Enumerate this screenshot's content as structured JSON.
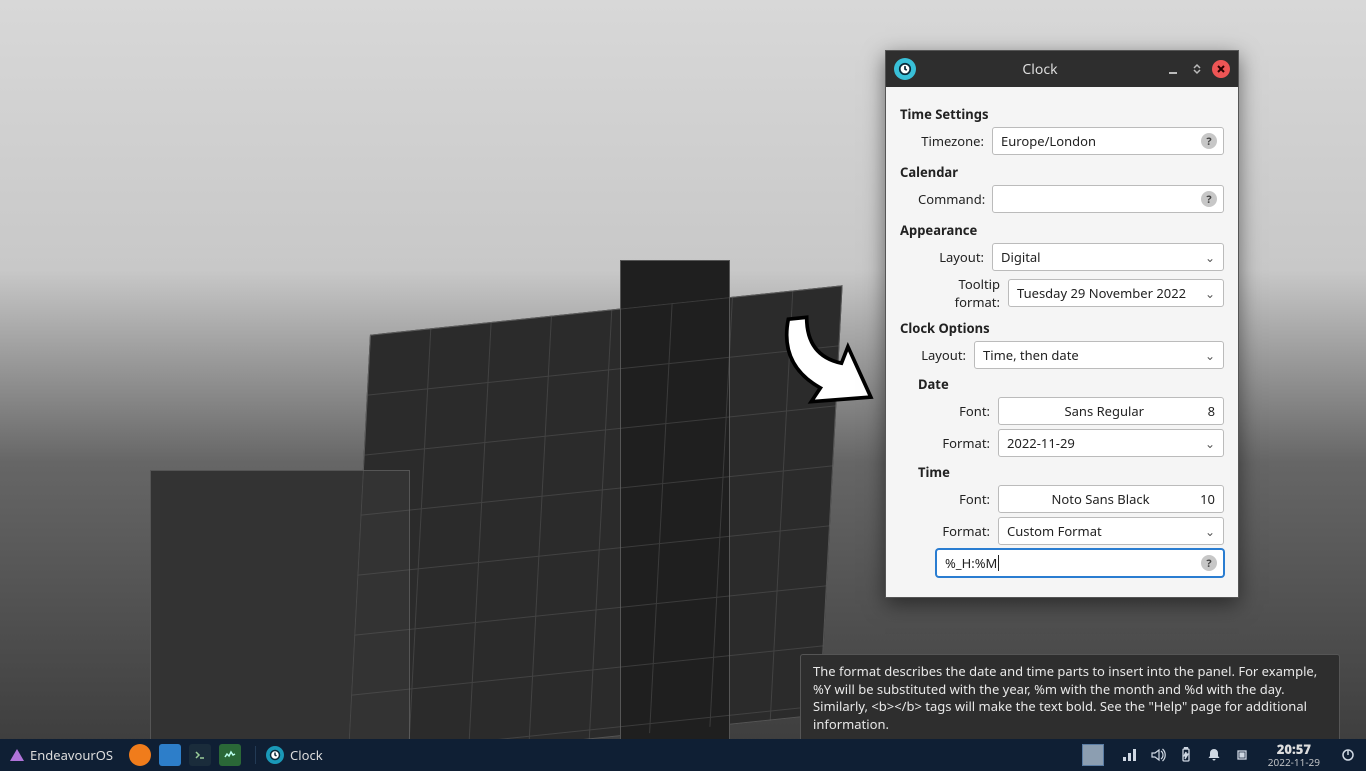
{
  "taskbar": {
    "os_label": "EndeavourOS",
    "active_task": "Clock",
    "clock_time": "20:57",
    "clock_date": "2022-11-29"
  },
  "dialog": {
    "title": "Clock",
    "sections": {
      "time_settings": {
        "heading": "Time Settings",
        "timezone_label": "Timezone:",
        "timezone_value": "Europe/London"
      },
      "calendar": {
        "heading": "Calendar",
        "command_label": "Command:",
        "command_value": ""
      },
      "appearance": {
        "heading": "Appearance",
        "layout_label": "Layout:",
        "layout_value": "Digital",
        "tooltip_label": "Tooltip format:",
        "tooltip_value": "Tuesday 29 November 2022"
      },
      "clock_options": {
        "heading": "Clock Options",
        "layout_label": "Layout:",
        "layout_value": "Time, then date",
        "date_heading": "Date",
        "date_font_label": "Font:",
        "date_font_name": "Sans Regular",
        "date_font_size": "8",
        "date_format_label": "Format:",
        "date_format_value": "2022-11-29",
        "time_heading": "Time",
        "time_font_label": "Font:",
        "time_font_name": "Noto Sans Black",
        "time_font_size": "10",
        "time_format_label": "Format:",
        "time_format_value": "Custom Format",
        "custom_format_value": "%_H:%M"
      }
    }
  },
  "tooltip_text": "The format describes the date and time parts to insert into the panel. For example, %Y will be substituted with the year, %m with the month and %d with the day. Similarly, <b></b> tags will make the text bold. See the \"Help\" page for additional information."
}
